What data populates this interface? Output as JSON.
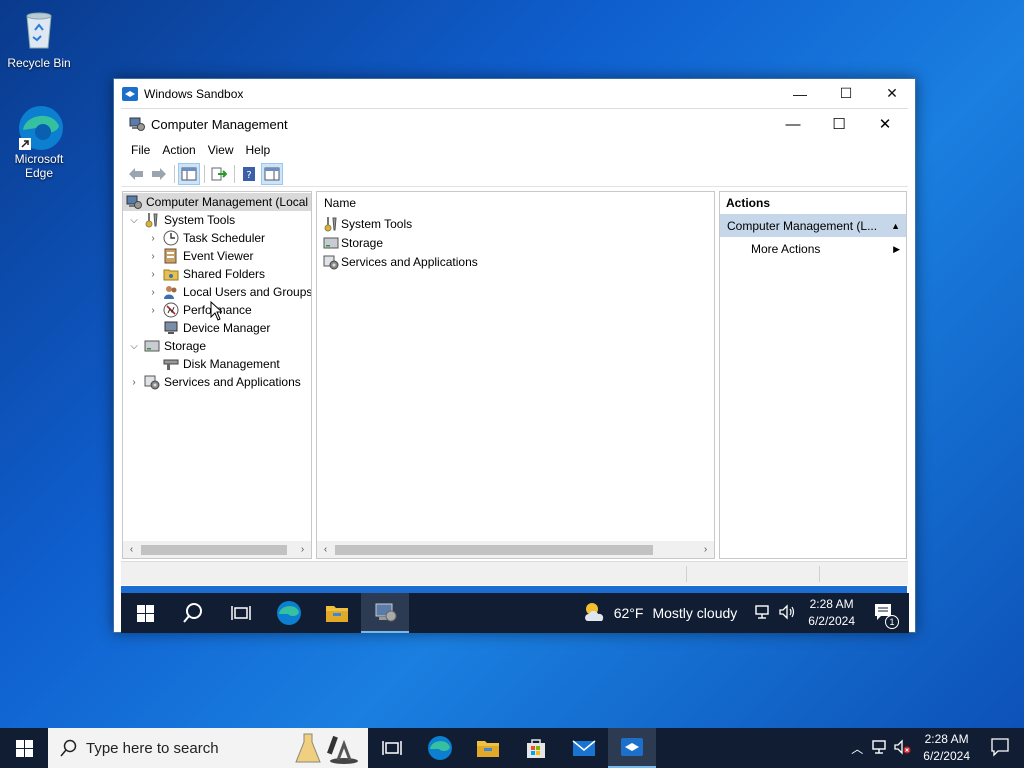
{
  "desktop": {
    "recycle_bin": "Recycle Bin",
    "edge_line1": "Microsoft",
    "edge_line2": "Edge"
  },
  "sandbox": {
    "title": "Windows Sandbox"
  },
  "cm": {
    "title": "Computer Management",
    "menu": [
      "File",
      "Action",
      "View",
      "Help"
    ],
    "tree": [
      {
        "label": "Computer Management (Local",
        "level": 0,
        "expander": ""
      },
      {
        "label": "System Tools",
        "level": 1,
        "expander": "open"
      },
      {
        "label": "Task Scheduler",
        "level": 2,
        "expander": "closed"
      },
      {
        "label": "Event Viewer",
        "level": 2,
        "expander": "closed"
      },
      {
        "label": "Shared Folders",
        "level": 2,
        "expander": "closed"
      },
      {
        "label": "Local Users and Groups",
        "level": 2,
        "expander": "closed"
      },
      {
        "label": "Performance",
        "level": 2,
        "expander": "closed"
      },
      {
        "label": "Device Manager",
        "level": 2,
        "expander": ""
      },
      {
        "label": "Storage",
        "level": 1,
        "expander": "open"
      },
      {
        "label": "Disk Management",
        "level": 2,
        "expander": ""
      },
      {
        "label": "Services and Applications",
        "level": 1,
        "expander": "closed"
      }
    ],
    "list_header": "Name",
    "list_items": [
      "System Tools",
      "Storage",
      "Services and Applications"
    ],
    "actions_title": "Actions",
    "actions_sub": "Computer Management (L...",
    "more_actions": "More Actions"
  },
  "inner_taskbar": {
    "temperature": "62°F",
    "weather": "Mostly cloudy",
    "time": "2:28 AM",
    "date": "6/2/2024",
    "notifications": "1"
  },
  "outer_taskbar": {
    "search_placeholder": "Type here to search",
    "time": "2:28 AM",
    "date": "6/2/2024"
  },
  "colors": {
    "taskbar": "#101d33",
    "selection": "#c6d7ea",
    "accent": "#1b6dd2"
  }
}
